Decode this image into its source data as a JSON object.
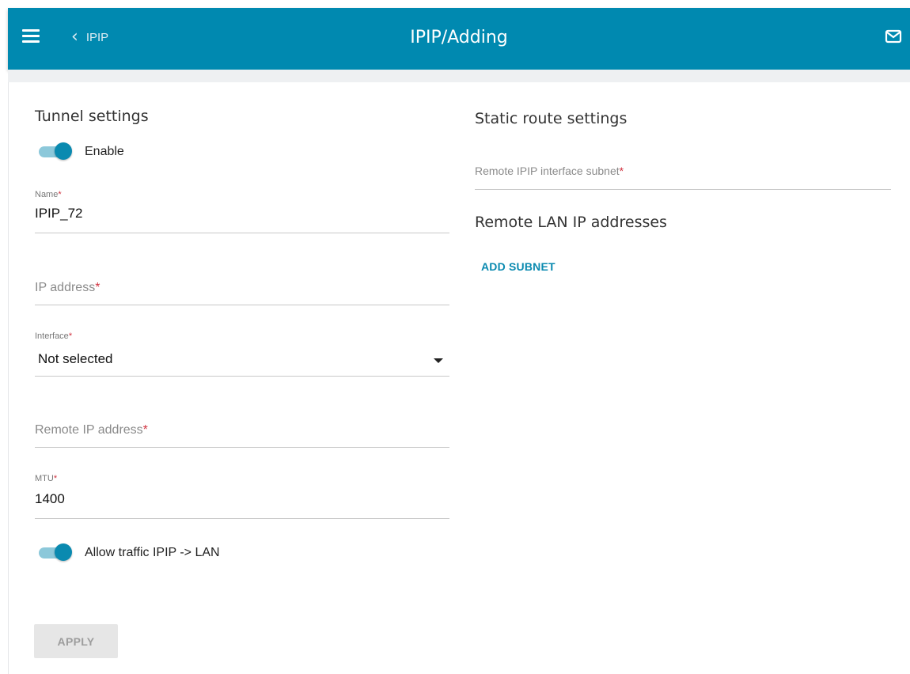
{
  "header": {
    "back_label": "IPIP",
    "title": "IPIP/Adding",
    "bg_color": "#0089b0"
  },
  "tunnel": {
    "title": "Tunnel settings",
    "enable_label": "Enable",
    "enable_on": true,
    "name_label": "Name",
    "name_value": "IPIP_72",
    "ip_placeholder": "IP address",
    "interface_label": "Interface",
    "interface_value": "Not selected",
    "remote_ip_placeholder": "Remote IP address",
    "mtu_label": "MTU",
    "mtu_value": "1400",
    "allow_traffic_label": "Allow traffic IPIP -> LAN",
    "allow_traffic_on": true,
    "required_mark": "*"
  },
  "static_route": {
    "title": "Static route settings",
    "subnet_placeholder": "Remote IPIP interface subnet",
    "remote_lan_title": "Remote LAN IP addresses",
    "add_subnet_label": "ADD SUBNET"
  },
  "actions": {
    "apply_label": "APPLY"
  },
  "colors": {
    "accent": "#0a8ab0",
    "required": "#d0323f"
  },
  "icons": {
    "menu": "hamburger-icon",
    "back": "chevron-left-icon",
    "mail": "mail-icon",
    "dropdown": "caret-down-icon"
  }
}
